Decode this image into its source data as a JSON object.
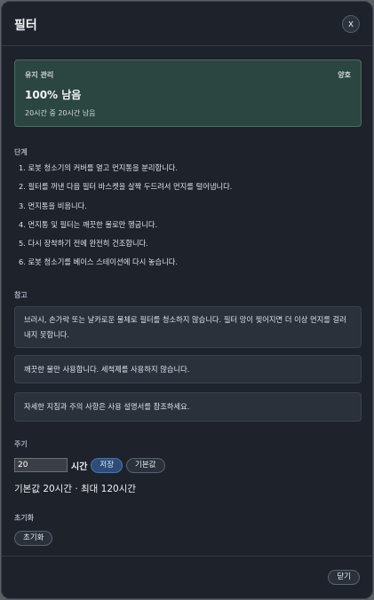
{
  "dialog": {
    "title": "필터",
    "close_label": "x"
  },
  "status": {
    "label": "유지 관리",
    "state": "양호",
    "value": "100% 남음",
    "detail": "20시간 중 20시간 남음"
  },
  "steps": {
    "title": "단계",
    "items": [
      "1. 로봇 청소기의 커버를 열고 먼지통을 분리합니다.",
      "2. 필터를 꺼낸 다음 필터 바스켓을 살짝 두드려서 먼지를 털어냅니다.",
      "3. 먼지통을 비웁니다.",
      "4. 먼지통 및 필터는 깨끗한 물로만 헹굽니다.",
      "5. 다시 장착하기 전에 완전히 건조합니다.",
      "6. 로봇 청소기를 베이스 스테이션에 다시 놓습니다."
    ]
  },
  "notes": {
    "title": "참고",
    "items": [
      "브러시, 손가락 또는 날카로운 물체로 필터를 청소하지 않습니다. 필터 망이 찢어지면 더 이상 먼지를 걸러 내지 못합니다.",
      "깨끗한 물만 사용합니다. 세척제를 사용하지 않습니다.",
      "자세한 지침과 주의 사항은 사용 설명서를 참조하세요."
    ]
  },
  "period": {
    "title": "주기",
    "value": "20",
    "unit": "시간",
    "save_label": "저장",
    "default_label": "기본값",
    "limits": "기본값 20시간 · 최대 120시간"
  },
  "reset": {
    "title": "초기화",
    "button_label": "초기화"
  },
  "footer": {
    "close_label": "닫기"
  },
  "colors": {
    "accent": "#2d4d78",
    "status_card": "#2b4541",
    "background": "#1d222b"
  }
}
